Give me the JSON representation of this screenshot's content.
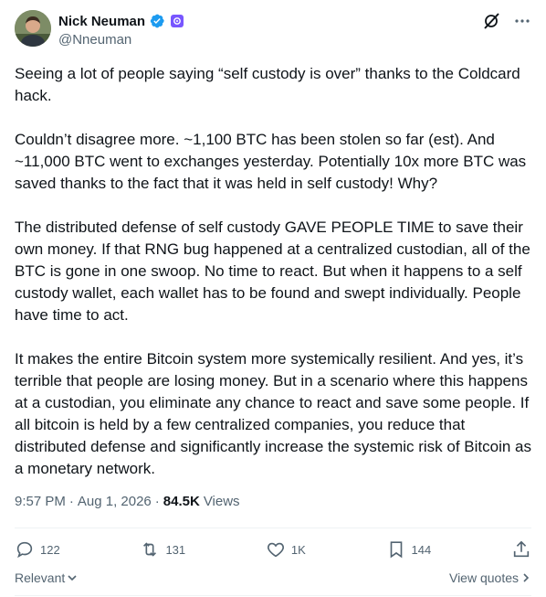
{
  "author": {
    "display_name": "Nick Neuman",
    "handle": "@Nneuman",
    "avatar_icon": "avatar-photo",
    "verified_icon": "verified-badge-icon",
    "affiliation_icon": "affiliate-badge-icon"
  },
  "header_actions": [
    {
      "icon": "grok-slash-icon"
    },
    {
      "icon": "more-icon"
    }
  ],
  "body": {
    "paragraphs": [
      "Seeing a lot of people saying “self custody is over” thanks to the Coldcard hack.",
      "Couldn’t disagree more. ~1,100 BTC has been stolen so far (est). And ~11,000 BTC went to exchanges yesterday. Potentially 10x more BTC was saved thanks to the fact that it was held in self custody! Why?",
      "The distributed defense of self custody GAVE PEOPLE TIME to save their own money. If that RNG bug happened at a centralized custodian, all of the BTC is gone in one swoop. No time to react. But when it happens to a self custody wallet, each wallet has to be found and swept individually. People have time to act.",
      "It makes the entire Bitcoin system more systemically resilient. And yes, it’s terrible that people are losing money. But in a scenario where this happens at a custodian, you eliminate any chance to react and save some people. If all bitcoin is held by a few centralized companies, you reduce that distributed defense and significantly increase the systemic risk of Bitcoin as a monetary network."
    ]
  },
  "meta": {
    "time": "9:57 PM",
    "separator": "·",
    "date": "Aug 1, 2026",
    "views_count": "84.5K",
    "views_label": "Views"
  },
  "actions": {
    "reply_count": "122",
    "repost_count": "131",
    "like_count": "1K",
    "bookmark_count": "144"
  },
  "footer": {
    "sort_label": "Relevant",
    "quotes_label": "View quotes"
  },
  "colors": {
    "text": "#0f1419",
    "secondary": "#536471",
    "verified": "#1d9bf0",
    "affiliate": "#7856ff",
    "divider": "#eff3f4"
  }
}
